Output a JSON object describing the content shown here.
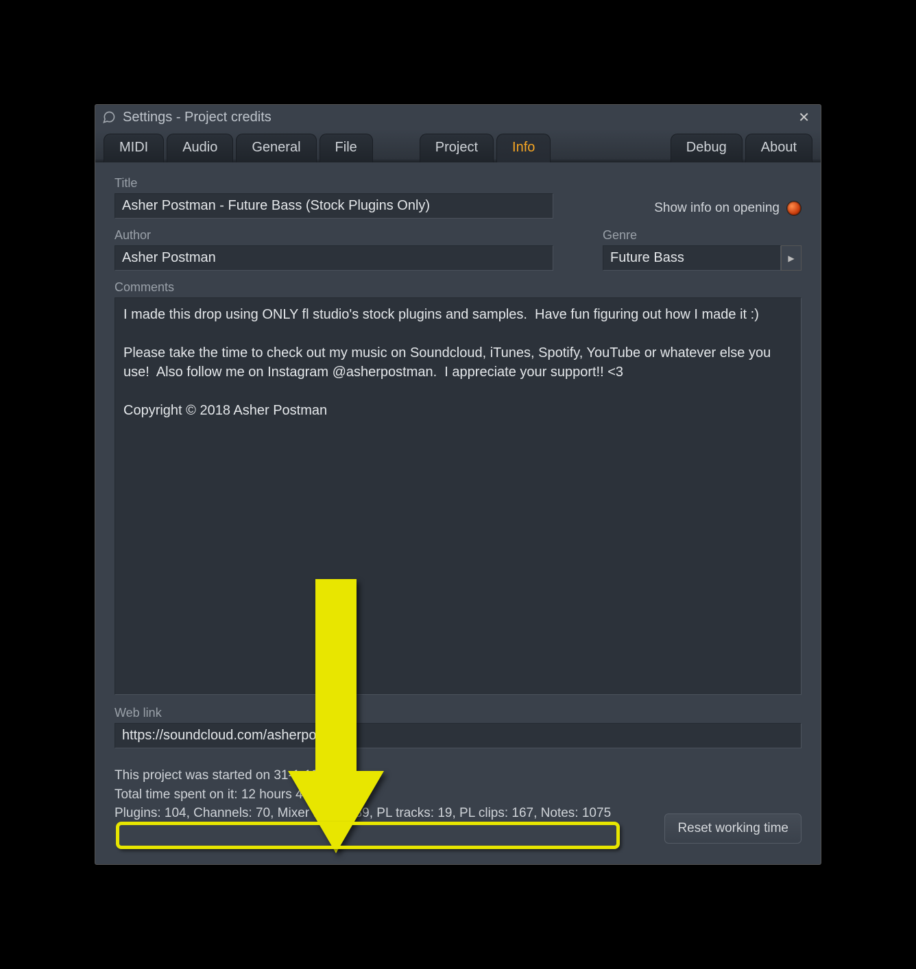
{
  "window": {
    "title": "Settings - Project credits"
  },
  "tabs": [
    "MIDI",
    "Audio",
    "General",
    "File",
    "Project",
    "Info",
    "Debug",
    "About"
  ],
  "active_tab": "Info",
  "labels": {
    "title": "Title",
    "author": "Author",
    "genre": "Genre",
    "comments": "Comments",
    "weblink": "Web link",
    "show_info": "Show info on opening"
  },
  "fields": {
    "title": "Asher Postman - Future Bass (Stock Plugins Only)",
    "author": "Asher Postman",
    "genre": "Future Bass",
    "comments": "I made this drop using ONLY fl studio's stock plugins and samples.  Have fun figuring out how I made it :)\n\nPlease take the time to check out my music on Soundcloud, iTunes, Spotify, YouTube or whatever else you use!  Also follow me on Instagram @asherpostman.  I appreciate your support!! <3\n\nCopyright © 2018 Asher Postman",
    "weblink": "https://soundcloud.com/asherpostman"
  },
  "footer": {
    "started": "This project was started on 31-1-18 21:15.",
    "time_spent": "Total time spent on it: 12 hours 40 minutes",
    "stats": "Plugins: 104, Channels: 70, Mixer tracks: 39, PL tracks: 19, PL clips: 167, Notes: 1075"
  },
  "buttons": {
    "reset": "Reset working time"
  }
}
